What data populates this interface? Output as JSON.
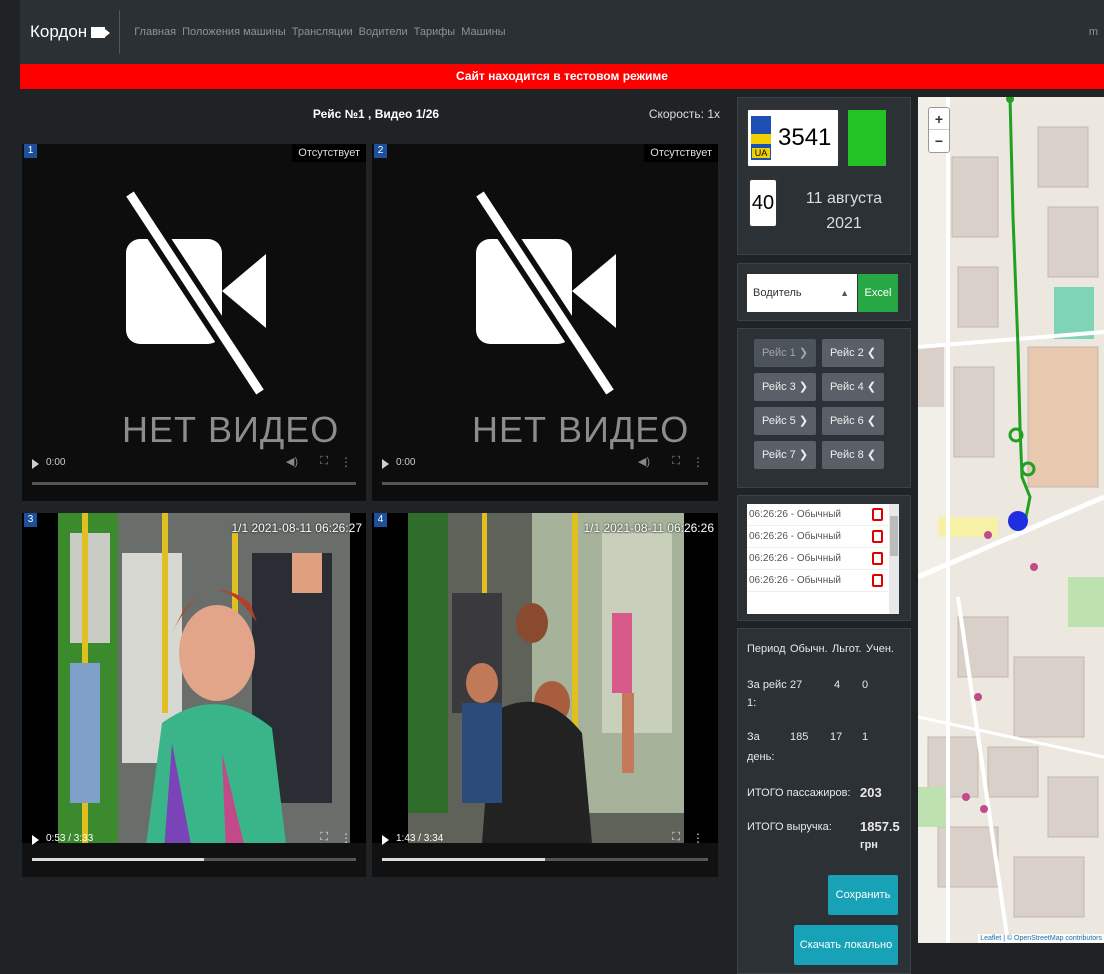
{
  "nav": {
    "brand": "Кордон",
    "links": [
      "Главная",
      "Положения машины",
      "Трансляции",
      "Водители",
      "Тарифы",
      "Машины"
    ],
    "right": "m"
  },
  "banner": "Сайт находится в тестовом режиме",
  "player": {
    "title": "Рейс №1 , Видео 1/26",
    "speed": "Скорость: 1х",
    "cells": [
      {
        "num": "1",
        "status": "Отсутствует",
        "placeholder": "НЕТ ВИДЕО",
        "time": "0:00",
        "progress": 0
      },
      {
        "num": "2",
        "status": "Отсутствует",
        "placeholder": "НЕТ ВИДЕО",
        "time": "0:00",
        "progress": 0
      },
      {
        "num": "3",
        "overlay": "1/1 2021-08-11 06:26:27",
        "time": "0:53 / 3:33",
        "progress": 0.53
      },
      {
        "num": "4",
        "overlay": "1/1 2021-08-11 06:26:26",
        "time": "1:43 / 3:34",
        "progress": 0.5
      }
    ]
  },
  "vehicle": {
    "country": "UA",
    "plate": "3541",
    "status_color": "#22c322",
    "route": "40",
    "date_line1": "11 августа",
    "date_line2": "2021"
  },
  "filter": {
    "select_value": "Водитель",
    "excel_label": "Excel"
  },
  "trips": [
    {
      "label": "Рейс 1 ❯",
      "disabled": true
    },
    {
      "label": "Рейс 2 ❮",
      "disabled": false
    },
    {
      "label": "Рейс 3 ❯",
      "disabled": false
    },
    {
      "label": "Рейс 4 ❮",
      "disabled": false
    },
    {
      "label": "Рейс 5 ❯",
      "disabled": false
    },
    {
      "label": "Рейс 6 ❮",
      "disabled": false
    },
    {
      "label": "Рейс 7 ❯",
      "disabled": false
    },
    {
      "label": "Рейс 8 ❮",
      "disabled": false
    }
  ],
  "passenger_list": [
    "06:26:26 - Обычный",
    "06:26:26 - Обычный",
    "06:26:26 - Обычный",
    "06:26:26 - Обычный"
  ],
  "stats": {
    "headers": [
      "Период",
      "Обычн.",
      "Льгот.",
      "Учен."
    ],
    "trip_label_1": "За рейс",
    "trip_label_2": "1:",
    "trip_values": [
      "27",
      "4",
      "0"
    ],
    "day_label_1": "За",
    "day_label_2": "день:",
    "day_values": [
      "185",
      "17",
      "1"
    ],
    "total_passengers_label": "ИТОГО пассажиров:",
    "total_passengers": "203",
    "total_revenue_label": "ИТОГО выручка:",
    "total_revenue": "1857.5",
    "currency": "грн",
    "save_label": "Сохранить",
    "download_label": "Скачать локально"
  },
  "map": {
    "zoom_in": "+",
    "zoom_out": "−",
    "attribution": "Leaflet | © OpenStreetMap contributors"
  }
}
